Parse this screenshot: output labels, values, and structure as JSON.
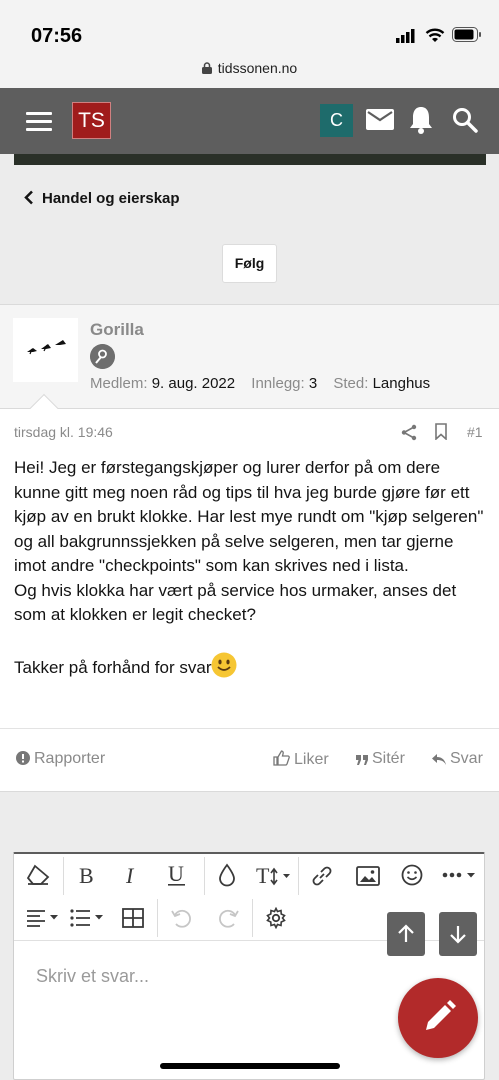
{
  "status_bar": {
    "time": "07:56"
  },
  "browser": {
    "url": "tidssonen.no"
  },
  "nav": {
    "logo_text": "TS",
    "user_initial": "C"
  },
  "breadcrumb": {
    "label": "Handel og eierskap"
  },
  "follow_button": {
    "label": "Følg"
  },
  "post": {
    "username": "Gorilla",
    "meta": {
      "member_label": "Medlem:",
      "member_value": "9. aug. 2022",
      "posts_label": "Innlegg:",
      "posts_value": "3",
      "location_label": "Sted:",
      "location_value": "Langhus"
    },
    "date": "tirsdag kl. 19:46",
    "number": "#1",
    "paragraphs": [
      "Hei! Jeg er førstegangskjøper og lurer derfor på om dere kunne gitt meg noen råd og tips til hva jeg burde gjøre før ett kjøp av en brukt klokke. Har lest mye rundt om \"kjøp selgeren\" og all bakgrunnssjekken på selve selgeren, men tar gjerne imot andre \"checkpoints\" som kan skrives ned i lista.",
      "Og hvis klokka har vært på service hos urmaker, anses det som at klokken er legit checket?",
      "Takker på forhånd for svar"
    ],
    "actions": {
      "report": "Rapporter",
      "like": "Liker",
      "quote": "Sitér",
      "reply": "Svar"
    }
  },
  "editor": {
    "placeholder": "Skriv et svar..."
  },
  "colors": {
    "nav_bg": "#5e5e5e",
    "logo_bg": "#a01c1c",
    "avatar_bg": "#1e6b6b",
    "fab_bg": "#b22a2a"
  },
  "icons": [
    "hamburger-icon",
    "mail-icon",
    "bell-icon",
    "search-icon",
    "chevron-left-icon",
    "share-icon",
    "bookmark-icon",
    "like-icon",
    "quote-icon",
    "reply-icon",
    "report-icon",
    "pencil-icon"
  ]
}
